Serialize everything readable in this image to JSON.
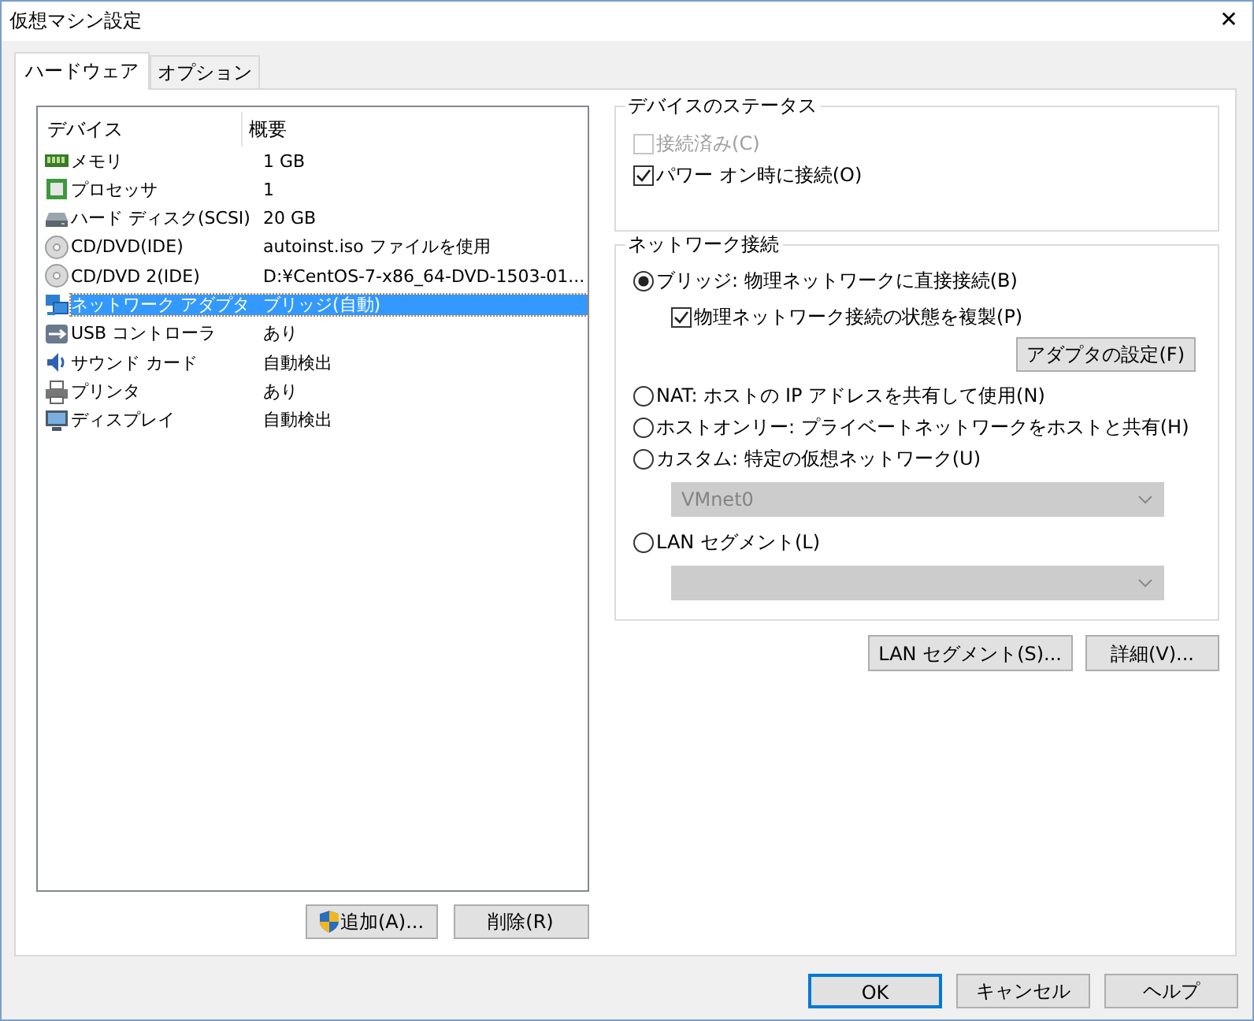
{
  "window": {
    "title": "仮想マシン設定",
    "close": "✕"
  },
  "tabs": [
    {
      "label": "ハードウェア",
      "selected": true
    },
    {
      "label": "オプション",
      "selected": false
    }
  ],
  "device_list": {
    "columns": [
      "デバイス",
      "概要"
    ],
    "rows": [
      {
        "kind": "memory",
        "device": "メモリ",
        "summary": "1 GB",
        "selected": false
      },
      {
        "kind": "cpu",
        "device": "プロセッサ",
        "summary": "1",
        "selected": false
      },
      {
        "kind": "disk",
        "device": "ハード ディスク(SCSI)",
        "summary": "20 GB",
        "selected": false
      },
      {
        "kind": "cd",
        "device": "CD/DVD(IDE)",
        "summary": "autoinst.iso ファイルを使用",
        "selected": false
      },
      {
        "kind": "cd",
        "device": "CD/DVD 2(IDE)",
        "summary": "D:¥CentOS-7-x86_64-DVD-1503-01...",
        "selected": false
      },
      {
        "kind": "network",
        "device": "ネットワーク アダプタ",
        "summary": "ブリッジ(自動)",
        "selected": true
      },
      {
        "kind": "usb",
        "device": "USB コントローラ",
        "summary": "あり",
        "selected": false
      },
      {
        "kind": "sound",
        "device": "サウンド カード",
        "summary": "自動検出",
        "selected": false
      },
      {
        "kind": "printer",
        "device": "プリンタ",
        "summary": "あり",
        "selected": false
      },
      {
        "kind": "display",
        "device": "ディスプレイ",
        "summary": "自動検出",
        "selected": false
      }
    ]
  },
  "device_buttons": [
    {
      "label": "追加(A)...",
      "shield": true
    },
    {
      "label": "削除(R)",
      "shield": false
    }
  ],
  "device_status": {
    "title": "デバイスのステータス",
    "options": [
      {
        "label": "接続済み(C)",
        "checked": false,
        "disabled": true
      },
      {
        "label": "パワー オン時に接続(O)",
        "checked": true,
        "disabled": false
      }
    ]
  },
  "network": {
    "title": "ネットワーク接続",
    "options": [
      {
        "label": "ブリッジ: 物理ネットワークに直接接続(B)",
        "selected": true,
        "children": [
          {
            "kind": "checkbox",
            "label": "物理ネットワーク接続の状態を複製(P)",
            "checked": true
          },
          {
            "kind": "button",
            "label": "アダプタの設定(F)"
          }
        ]
      },
      {
        "label": "NAT: ホストの IP アドレスを共有して使用(N)",
        "selected": false
      },
      {
        "label": "ホストオンリー: プライベートネットワークをホストと共有(H)",
        "selected": false
      },
      {
        "label": "カスタム: 特定の仮想ネットワーク(U)",
        "selected": false,
        "children": [
          {
            "kind": "select",
            "value": "VMnet0",
            "disabled": true
          }
        ]
      },
      {
        "label": "LAN セグメント(L)",
        "selected": false,
        "children": [
          {
            "kind": "select",
            "disabled": true
          }
        ]
      }
    ]
  },
  "network_buttons": [
    "LAN セグメント(S)...",
    "詳細(V)..."
  ],
  "dialog_buttons": [
    {
      "label": "OK",
      "default": true
    },
    {
      "label": "キャンセル",
      "default": false
    },
    {
      "label": "ヘルプ",
      "default": false
    }
  ]
}
